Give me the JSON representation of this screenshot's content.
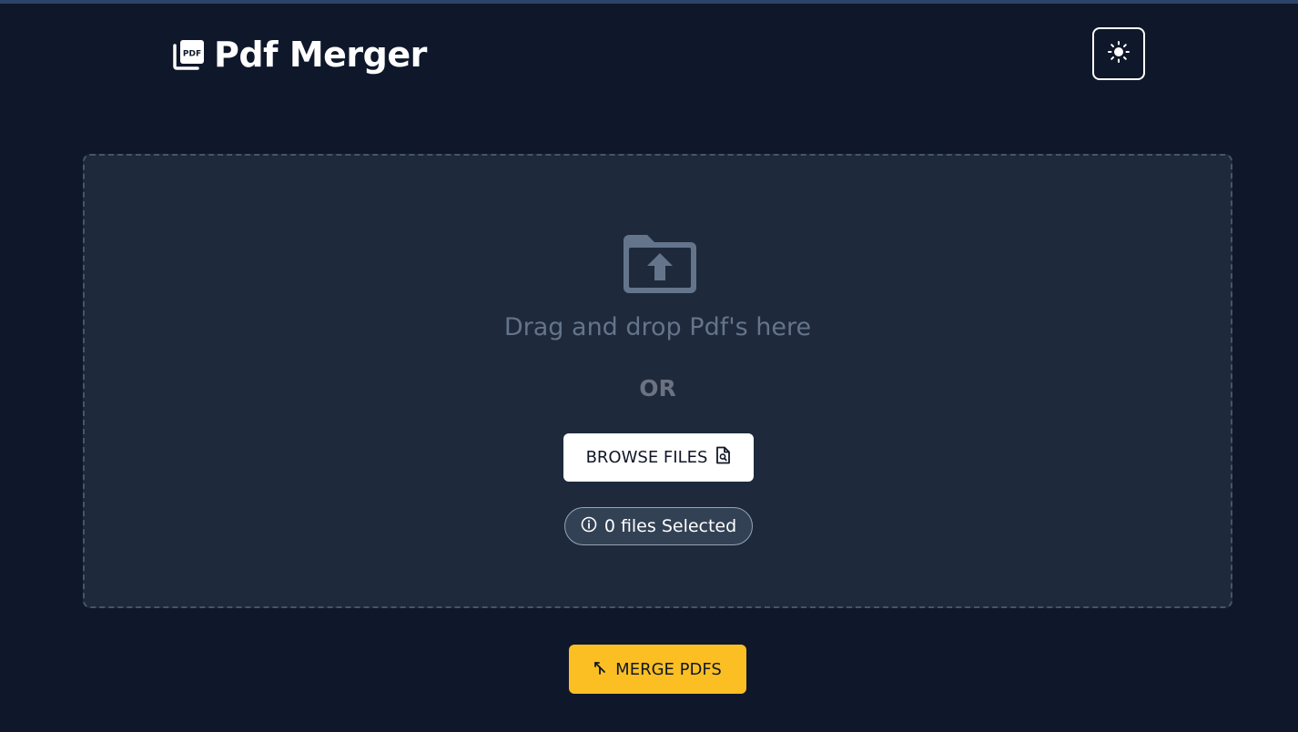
{
  "header": {
    "title": "Pdf Merger",
    "logo_icon": "pdf-files-icon",
    "logo_text": "PDF",
    "theme_toggle_icon": "sun-icon"
  },
  "dropzone": {
    "icon": "folder-upload-icon",
    "drag_text": "Drag and drop Pdf's here",
    "or_text": "OR",
    "browse_label": "BROWSE FILES",
    "browse_icon": "file-search-icon",
    "files_selected": "0 files Selected",
    "info_icon": "info-icon"
  },
  "actions": {
    "merge_label": "MERGE PDFS",
    "merge_icon": "merge-icon"
  },
  "colors": {
    "background": "#0f172a",
    "dropzone_bg": "#1e293b",
    "accent": "#fbbf24",
    "muted_text": "#64748b"
  }
}
